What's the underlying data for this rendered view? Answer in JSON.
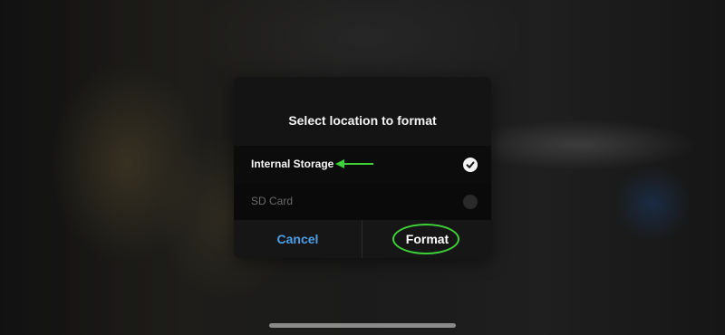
{
  "dialog": {
    "title": "Select location to format",
    "options": [
      {
        "label": "Internal Storage",
        "selected": true
      },
      {
        "label": "SD Card",
        "selected": false
      }
    ],
    "cancel_label": "Cancel",
    "confirm_label": "Format"
  },
  "colors": {
    "cancel_text": "#4aa0e6",
    "annotation_green": "#3ed23a",
    "dialog_bg": "#141414"
  },
  "icons": {
    "check": "checkmark-icon",
    "arrow": "left-arrow-icon"
  }
}
